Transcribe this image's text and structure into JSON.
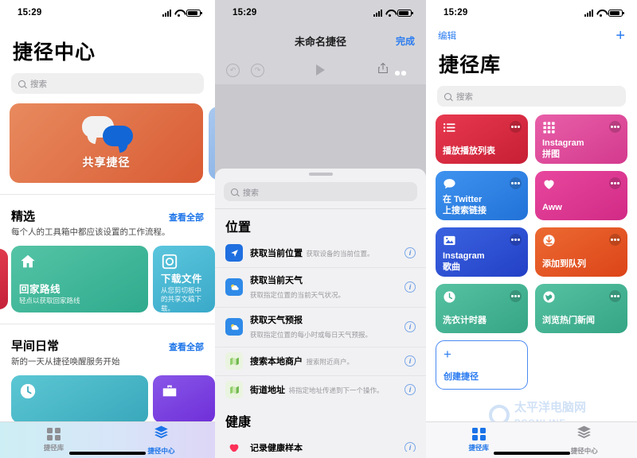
{
  "statusbar": {
    "time": "15:29"
  },
  "panel1": {
    "title": "捷径中心",
    "search_placeholder": "搜索",
    "banner": {
      "label": "共享捷径",
      "icon": "speech-bubbles-icon",
      "color": "#d95b34"
    },
    "sections": [
      {
        "title": "精选",
        "see_all": "查看全部",
        "subtitle": "每个人的工具箱中都应该设置的工作流程。",
        "cards": [
          {
            "name": "回家路线",
            "desc": "轻点以获取回家路线",
            "icon": "home-icon",
            "color": "#2faa8d"
          },
          {
            "name": "下载文件",
            "desc": "从您剪切板中的共享文稿下载。",
            "icon": "disk-icon",
            "color": "#3aa9c9"
          }
        ]
      },
      {
        "title": "早间日常",
        "see_all": "查看全部",
        "subtitle": "新的一天从捷径唤醒服务开始",
        "cards": [
          {
            "name": "",
            "desc": "",
            "icon": "clock-icon",
            "color": "#39a8bb"
          },
          {
            "name": "",
            "desc": "",
            "icon": "briefcase-icon",
            "color": "#6f2fd8"
          }
        ]
      }
    ],
    "tabs": [
      {
        "label": "捷径库",
        "icon": "grid-icon",
        "active": false
      },
      {
        "label": "捷径中心",
        "icon": "layers-icon",
        "active": true
      }
    ]
  },
  "panel2": {
    "nav": {
      "title": "未命名捷径",
      "done": "完成"
    },
    "toolbar": [
      {
        "name": "undo-icon",
        "enabled": false
      },
      {
        "name": "redo-icon",
        "enabled": false
      },
      {
        "name": "play-icon",
        "enabled": true
      },
      {
        "name": "share-icon",
        "enabled": true
      },
      {
        "name": "settings-toggles-icon",
        "enabled": true
      }
    ],
    "sheet": {
      "search_placeholder": "搜索",
      "groups": [
        {
          "title": "位置",
          "actions": [
            {
              "name": "获取当前位置",
              "desc": "获取设备的当前位置。",
              "icon": "location-arrow-icon",
              "color": "#1f6fe0"
            },
            {
              "name": "获取当前天气",
              "desc": "获取指定位置的当前天气状况。",
              "icon": "weather-sun-cloud-icon",
              "color": "#2f8ae8"
            },
            {
              "name": "获取天气预报",
              "desc": "获取指定位置的每小时或每日天气预报。",
              "icon": "weather-sun-cloud-icon",
              "color": "#2f8ae8"
            },
            {
              "name": "搜索本地商户",
              "desc": "搜索附近商户。",
              "icon": "maps-icon",
              "color": "#8fce6a"
            },
            {
              "name": "街道地址",
              "desc": "将指定地址传递到下一个操作。",
              "icon": "maps-icon",
              "color": "#8fce6a"
            }
          ]
        },
        {
          "title": "健康",
          "actions": [
            {
              "name": "记录健康样本",
              "desc": "",
              "icon": "heart-icon",
              "color": "#fc3158"
            }
          ]
        }
      ]
    }
  },
  "panel3": {
    "nav": {
      "edit": "编辑",
      "add": "+"
    },
    "title": "捷径库",
    "search_placeholder": "搜索",
    "cards": [
      {
        "name": "播放播放列表",
        "icon": "list-icon",
        "color_a": "#e8394f",
        "color_b": "#c71f35"
      },
      {
        "name": "Instagram\n拼图",
        "icon": "grid9-icon",
        "color_a": "#e85fa8",
        "color_b": "#d43a8e"
      },
      {
        "name": "在 Twitter\n上搜索链接",
        "icon": "bubble-icon",
        "color_a": "#3f93ef",
        "color_b": "#2272d8"
      },
      {
        "name": "Aww",
        "icon": "heart-icon",
        "color_a": "#e8479e",
        "color_b": "#d12a86"
      },
      {
        "name": "Instagram\n歌曲",
        "icon": "photo-icon",
        "color_a": "#3a63e0",
        "color_b": "#2340c6"
      },
      {
        "name": "添加到队列",
        "icon": "download-icon",
        "color_a": "#ec6a32",
        "color_b": "#dc4418"
      },
      {
        "name": "洗衣计时器",
        "icon": "clock-icon",
        "color_a": "#56c2a2",
        "color_b": "#35a585"
      },
      {
        "name": "浏览热门新闻",
        "icon": "globe-icon",
        "color_a": "#56c2a2",
        "color_b": "#35a585"
      }
    ],
    "create": {
      "label": "创建捷径",
      "plus": "+"
    },
    "tabs": [
      {
        "label": "捷径库",
        "icon": "grid-icon",
        "active": true
      },
      {
        "label": "捷径中心",
        "icon": "layers-icon",
        "active": false
      }
    ],
    "watermark": {
      "line1": "太平洋电脑网",
      "line2": "PCONLINE"
    }
  }
}
